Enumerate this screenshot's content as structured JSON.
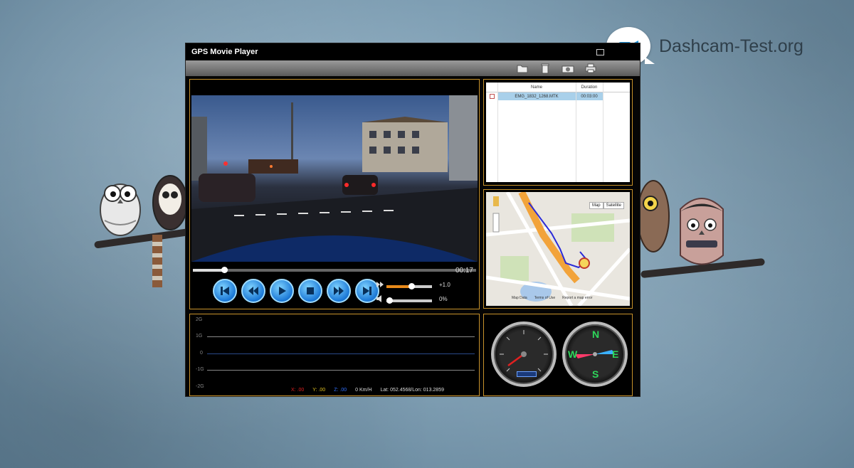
{
  "window": {
    "title": "GPS Movie Player"
  },
  "brand": {
    "text": "Dashcam-Test.org"
  },
  "toolbar": {
    "icons": [
      "folder-icon",
      "trash-icon",
      "camera-icon",
      "printer-icon"
    ]
  },
  "player": {
    "time": "00:17",
    "seek_fraction": 0.11,
    "speed_value": "+1.0",
    "speed_fraction": 0.55,
    "volume_value": "0%",
    "volume_fraction": 0.0,
    "controls": [
      "first",
      "rewind",
      "play",
      "stop",
      "fast-forward",
      "last"
    ]
  },
  "file_list": {
    "columns": [
      "Name",
      "Duration"
    ],
    "rows": [
      {
        "name": "EMG_1832_1268.MTK",
        "duration": "00:03:00",
        "selected": true
      }
    ]
  },
  "map": {
    "buttons": [
      "Map",
      "Satellite"
    ],
    "footer": [
      "Map Data",
      "Terms of Use",
      "Report a map error"
    ]
  },
  "graph": {
    "labels": [
      "2G",
      "1G",
      "0",
      "-1G",
      "-2G"
    ],
    "readouts": {
      "x": "X: .00",
      "y": "Y: .00",
      "z": "Z: .00",
      "speed": "0 Km/H",
      "latlon": "Lat: 052.4568/Lon: 013.2859"
    },
    "colors": {
      "x": "#e02020",
      "y": "#e0c020",
      "z": "#3070ff",
      "speed": "#dddddd"
    }
  },
  "gauges": {
    "compass_letters": {
      "n": "N",
      "s": "S",
      "e": "E",
      "w": "W"
    }
  }
}
